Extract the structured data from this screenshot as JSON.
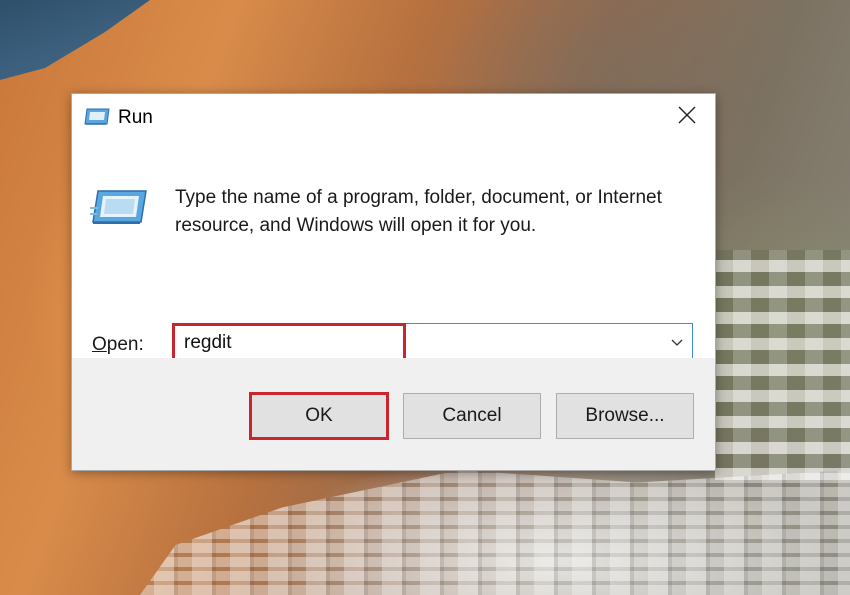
{
  "dialog": {
    "title": "Run",
    "description": "Type the name of a program, folder, document, or Internet resource, and Windows will open it for you.",
    "open_label_accesskey": "O",
    "open_label_rest": "pen:",
    "open_value": "regdit",
    "buttons": {
      "ok": "OK",
      "cancel": "Cancel",
      "browse": "Browse..."
    }
  },
  "icons": {
    "title": "run-icon",
    "body": "run-icon",
    "close": "close-icon",
    "dropdown": "chevron-down-icon"
  },
  "colors": {
    "highlight_border": "#c8252f",
    "focus_border": "#0078d7",
    "footer_bg": "#f0f0f0"
  }
}
